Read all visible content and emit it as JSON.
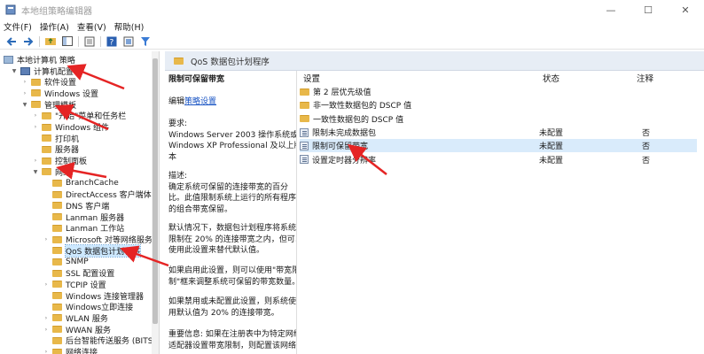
{
  "window": {
    "title": "本地组策略编辑器",
    "minimize": "—",
    "maximize": "☐",
    "close": "✕"
  },
  "menu": [
    "文件(F)",
    "操作(A)",
    "查看(V)",
    "帮助(H)"
  ],
  "tree": {
    "root": "本地计算机 策略",
    "computer_config": "计算机配置",
    "software_settings": "软件设置",
    "windows_settings": "Windows 设置",
    "admin_templates": "管理模板",
    "start_menu": "\"开始\"菜单和任务栏",
    "windows_components": "Windows 组件",
    "printers": "打印机",
    "server": "服务器",
    "control_panel": "控制面板",
    "network": "网络",
    "branchcache": "BranchCache",
    "directaccess": "DirectAccess 客户端体验",
    "dns_client": "DNS 客户端",
    "lanman_server": "Lanman 服务器",
    "lanman_workstation": "Lanman 工作站",
    "ms_peer": "Microsoft 对等网络服务",
    "qos": "QoS 数据包计划程序",
    "snmp": "SNMP",
    "ssl": "SSL 配置设置",
    "tcpip": "TCPIP 设置",
    "win_conn_mgr": "Windows 连接管理器",
    "win_instant": "Windows立即连接",
    "wlan": "WLAN 服务",
    "wwan": "WWAN 服务",
    "bits": "后台智能传送服务 (BITS)",
    "more": "网络连接"
  },
  "header": {
    "title": "QoS 数据包计划程序"
  },
  "description": {
    "title": "限制可保留带宽",
    "edit_prefix": "编辑",
    "edit_link": "策略设置",
    "req_label": "要求:",
    "req_1": "Windows Server 2003 操作系统或",
    "req_2": "Windows XP Professional 及以上版",
    "req_3": "本",
    "desc_label": "描述:",
    "desc_1": "确定系统可保留的连接带宽的百分",
    "desc_2": "比。此值限制系统上运行的所有程序",
    "desc_3": "的组合带宽保留。",
    "desc_4": "默认情况下，数据包计划程序将系统",
    "desc_5": "限制在 20% 的连接带宽之内，但可以",
    "desc_6": "使用此设置来替代默认值。",
    "desc_7": "如果启用此设置，则可以使用\"带宽限",
    "desc_8": "制\"框来调整系统可保留的带宽数量。",
    "desc_9": "如果禁用或未配置此设置，则系统使",
    "desc_10": "用默认值为 20% 的连接带宽。",
    "desc_11": "重要信息: 如果在注册表中为特定网络",
    "desc_12": "适配器设置带宽限制，则配置该网络"
  },
  "columns": {
    "setting": "设置",
    "state": "状态",
    "comment": "注释"
  },
  "rows": [
    {
      "name": "第 2 层优先级值",
      "state": "",
      "comment": ""
    },
    {
      "name": "非一致性数据包的 DSCP 值",
      "state": "",
      "comment": ""
    },
    {
      "name": "一致性数据包的 DSCP 值",
      "state": "",
      "comment": ""
    },
    {
      "name": "限制未完成数据包",
      "state": "未配置",
      "comment": "否"
    },
    {
      "name": "限制可保留带宽",
      "state": "未配置",
      "comment": "否"
    },
    {
      "name": "设置定时器分辨率",
      "state": "未配置",
      "comment": "否"
    }
  ],
  "colors": {
    "arrow": "#e52424",
    "selection": "#d9ebfb",
    "header_bg": "#e7edf5",
    "folder": "#e8b84a"
  }
}
